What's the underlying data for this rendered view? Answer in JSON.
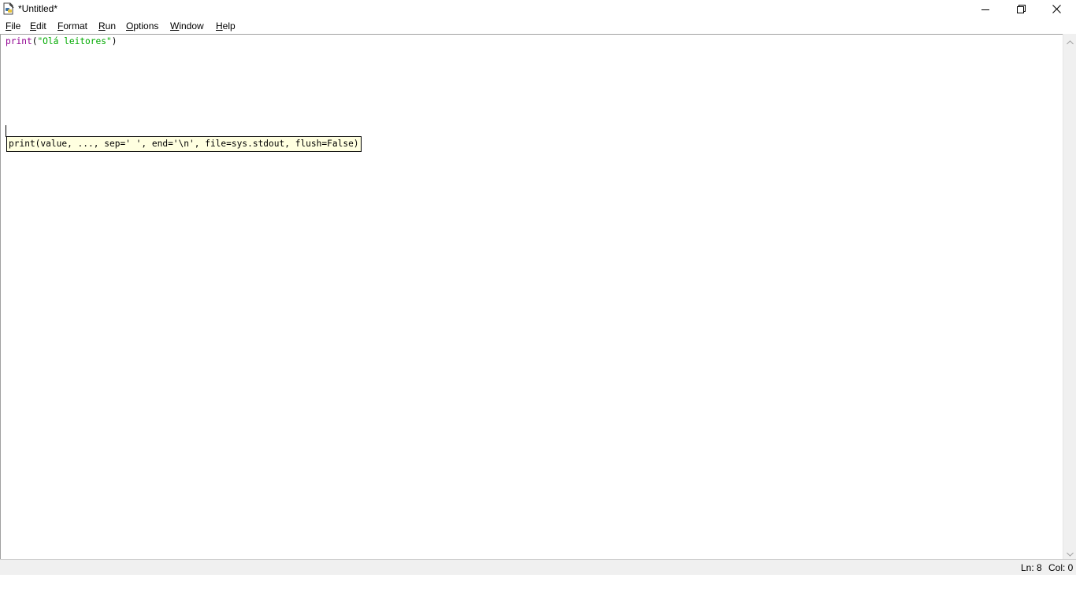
{
  "window": {
    "title": "*Untitled*"
  },
  "menubar": {
    "items": [
      {
        "first": "F",
        "rest": "ile"
      },
      {
        "first": "E",
        "rest": "dit"
      },
      {
        "first": "F",
        "rest": "ormat"
      },
      {
        "first": "R",
        "rest": "un"
      },
      {
        "first": "O",
        "rest": "ptions"
      },
      {
        "first": "W",
        "rest": "indow"
      },
      {
        "first": "H",
        "rest": "elp"
      }
    ]
  },
  "editor": {
    "line1": {
      "builtin": "print",
      "open": "(",
      "string": "\"Olá leitores\"",
      "close": ")"
    },
    "calltip": "print(value, ..., sep=' ', end='\\n', file=sys.stdout, flush=False)"
  },
  "statusbar": {
    "line": "Ln: 8",
    "column": "Col: 0"
  },
  "colors": {
    "builtin": "#900090",
    "string": "#00aa00",
    "calltip_bg": "#ffffe0"
  },
  "icons": {
    "app": "idle-python-file-icon",
    "minimize": "minimize-icon",
    "maximize": "restore-icon",
    "close": "close-icon"
  }
}
